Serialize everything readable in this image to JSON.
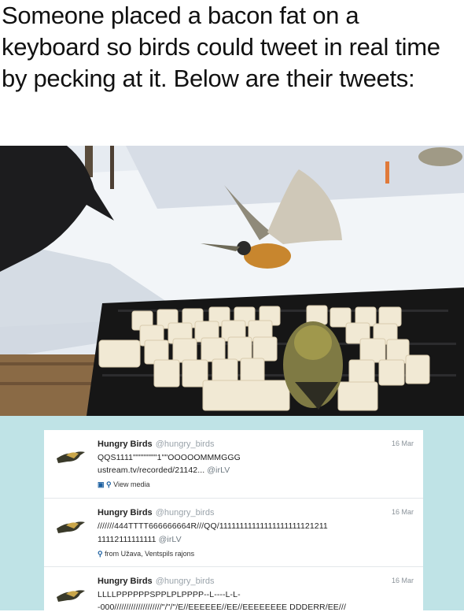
{
  "caption": "Someone placed a bacon fat on a keyboard so birds could tweet in real time by pecking at it. Below are their tweets:",
  "colors": {
    "feed_bg": "#bfe3e6",
    "card_bg": "#ffffff",
    "name": "#222222",
    "muted": "#9aa3aa"
  },
  "tweets": [
    {
      "name": "Hungry Birds",
      "handle": "@hungry_birds",
      "date": "16 Mar",
      "lines": [
        "QQS1111\"\"\"\"\"\"\"\"1\"\"OOOOOMMMGGG",
        "ustream.tv/recorded/21142..."
      ],
      "mention": "@irLV",
      "meta": "View media",
      "meta_icon": "media-location-icon"
    },
    {
      "name": "Hungry Birds",
      "handle": "@hungry_birds",
      "date": "16 Mar",
      "lines": [
        "///////444TTTT666666664R///QQ/11111111111111111111121211",
        "11112111111111"
      ],
      "mention": "@irLV",
      "meta": "from Užava, Ventspils rajons",
      "meta_icon": "location-pin-icon"
    },
    {
      "name": "Hungry Birds",
      "handle": "@hungry_birds",
      "date": "16 Mar",
      "lines": [
        "LLLLPPPPPPSPPLPLPPPP--L----L-L-",
        "-000////////////////////\"/\"/\"/E//EEEEEE//EE//EEEEEEEE DDDERR/EE///"
      ],
      "mention": "",
      "meta": "",
      "meta_icon": ""
    }
  ]
}
